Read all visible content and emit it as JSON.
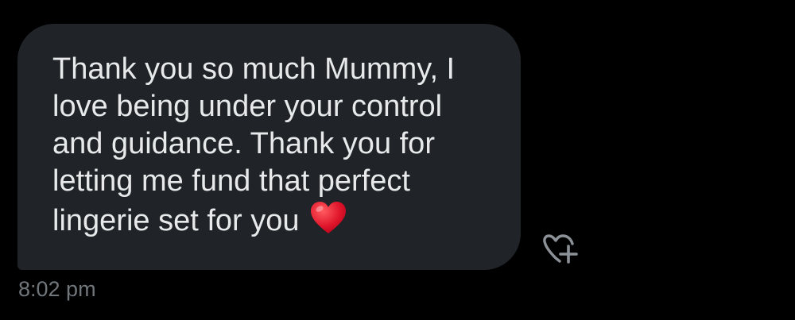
{
  "message": {
    "lines": [
      "Thank you so much Mummy, I",
      "love being under your control",
      "and guidance. Thank you for",
      "letting me fund that perfect",
      "lingerie set for you"
    ],
    "emoji": "red-heart-emoji",
    "timestamp": "8:02 pm"
  },
  "reaction": {
    "icon": "add-reaction-heart-icon"
  },
  "colors": {
    "background": "#000000",
    "bubble": "#202327",
    "text": "#e7e9ea",
    "muted": "#71767b",
    "heart": "#e0162b"
  }
}
